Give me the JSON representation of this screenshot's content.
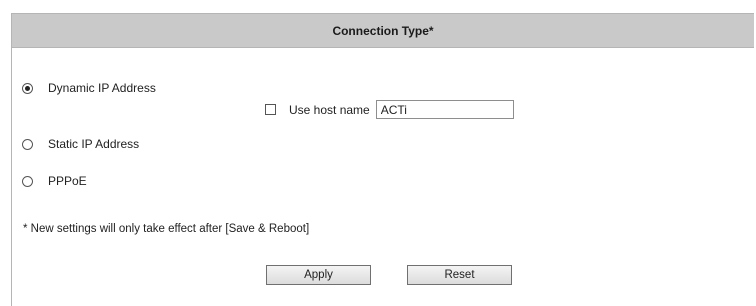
{
  "header": {
    "title": "Connection Type*"
  },
  "options": [
    {
      "label": "Dynamic IP Address",
      "selected": true
    },
    {
      "label": "Static IP Address",
      "selected": false
    },
    {
      "label": "PPPoE",
      "selected": false
    }
  ],
  "host_name": {
    "label": "Use host name",
    "checked": false,
    "value": "ACTi"
  },
  "note": "* New settings will only take effect after [Save & Reboot]",
  "buttons": {
    "apply": "Apply",
    "reset": "Reset"
  }
}
